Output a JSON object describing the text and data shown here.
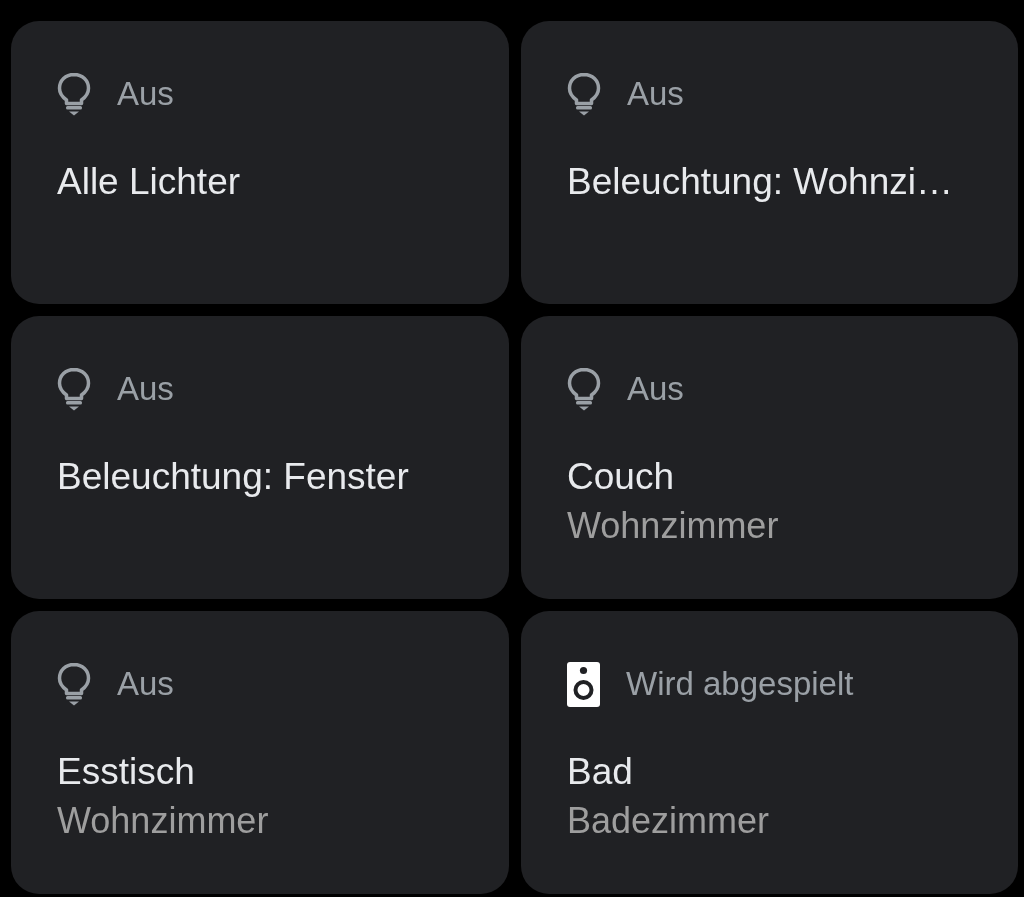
{
  "tiles": [
    {
      "kind": "light",
      "active": false,
      "status": "Aus",
      "name": "Alle Lichter"
    },
    {
      "kind": "light",
      "active": false,
      "status": "Aus",
      "name": "Beleuchtung: Wohnzi…"
    },
    {
      "kind": "light",
      "active": false,
      "status": "Aus",
      "name": "Beleuchtung: Fenster"
    },
    {
      "kind": "light",
      "active": false,
      "status": "Aus",
      "name": "Couch",
      "room": "Wohnzimmer"
    },
    {
      "kind": "light",
      "active": false,
      "status": "Aus",
      "name": "Esstisch",
      "room": "Wohnzimmer"
    },
    {
      "kind": "speaker",
      "active": true,
      "status": "Wird abgespielt",
      "name": "Bad",
      "room": "Badezimmer"
    }
  ]
}
